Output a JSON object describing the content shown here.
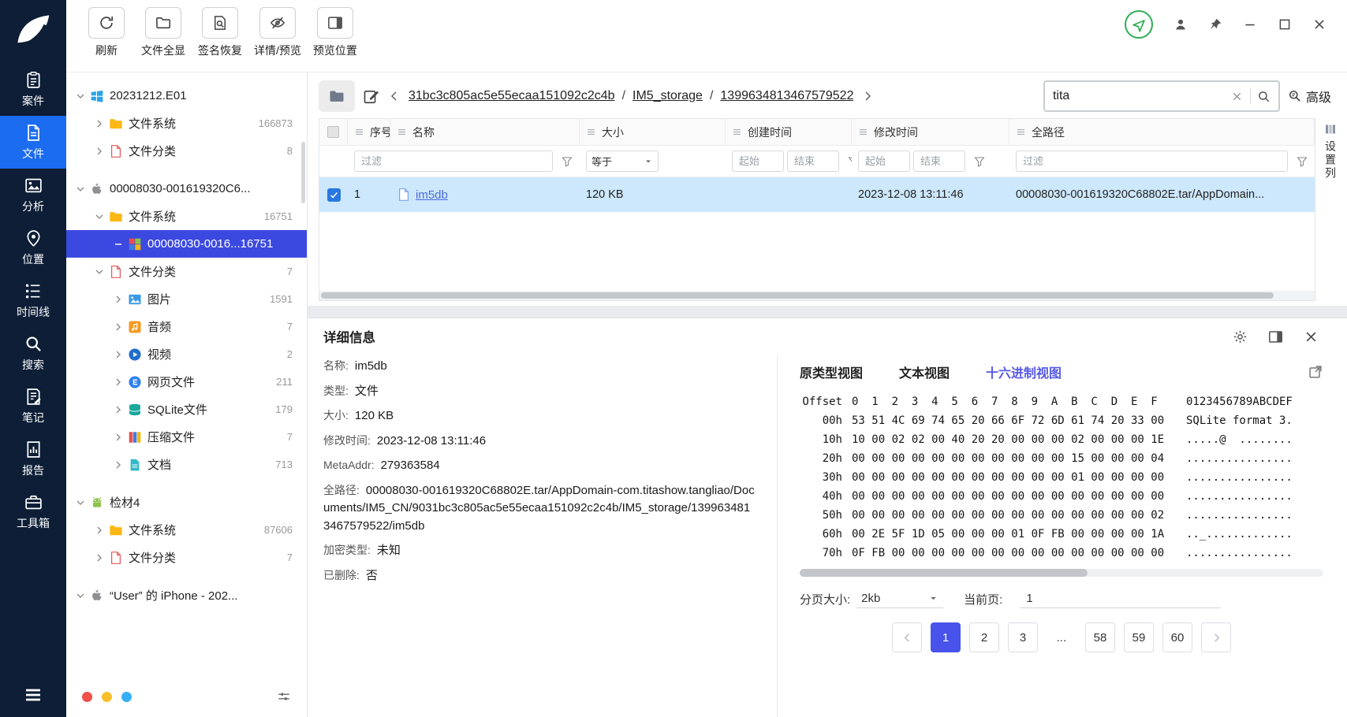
{
  "nav": {
    "items": [
      {
        "id": "case",
        "label": "案件",
        "icon": "case-icon",
        "active": false
      },
      {
        "id": "files",
        "label": "文件",
        "icon": "files-icon",
        "active": true
      },
      {
        "id": "analysis",
        "label": "分析",
        "icon": "analysis-icon",
        "active": false
      },
      {
        "id": "location",
        "label": "位置",
        "icon": "location-icon",
        "active": false
      },
      {
        "id": "timeline",
        "label": "时间线",
        "icon": "timeline-icon",
        "active": false
      },
      {
        "id": "search",
        "label": "搜索",
        "icon": "search-icon",
        "active": false
      },
      {
        "id": "notes",
        "label": "笔记",
        "icon": "notes-icon",
        "active": false
      },
      {
        "id": "report",
        "label": "报告",
        "icon": "report-icon",
        "active": false
      },
      {
        "id": "toolbox",
        "label": "工具箱",
        "icon": "toolbox-icon",
        "active": false
      }
    ]
  },
  "toolbar": {
    "buttons": [
      {
        "id": "refresh",
        "label": "刷新",
        "icon": "refresh-icon"
      },
      {
        "id": "show-all-files",
        "label": "文件全显",
        "icon": "folder-icon"
      },
      {
        "id": "signature-recovery",
        "label": "签名恢复",
        "icon": "signature-icon"
      },
      {
        "id": "detail-preview",
        "label": "详情/预览",
        "icon": "eye-off-icon"
      },
      {
        "id": "preview-position",
        "label": "预览位置",
        "icon": "layout-icon"
      }
    ]
  },
  "tree": {
    "items": [
      {
        "level": 0,
        "chev": "down",
        "icon": "windows",
        "label": "20231212.E01",
        "count": "",
        "selected": false
      },
      {
        "level": 1,
        "chev": "right",
        "icon": "folder",
        "label": "文件系统",
        "count": "166873",
        "selected": false
      },
      {
        "level": 1,
        "chev": "right",
        "icon": "file-cat",
        "label": "文件分类",
        "count": "8",
        "selected": false
      },
      {
        "level": 0,
        "chev": "down",
        "icon": "apple",
        "label": "00008030-001619320C6...",
        "count": "",
        "selected": false
      },
      {
        "level": 1,
        "chev": "down",
        "icon": "folder",
        "label": "文件系统",
        "count": "16751",
        "selected": false
      },
      {
        "level": 2,
        "chev": "minus",
        "icon": "disk",
        "label": "00008030-0016...16751",
        "count": "",
        "selected": true
      },
      {
        "level": 1,
        "chev": "down",
        "icon": "file-cat",
        "label": "文件分类",
        "count": "7",
        "selected": false
      },
      {
        "level": 2,
        "chev": "right",
        "icon": "image",
        "label": "图片",
        "count": "1591",
        "selected": false
      },
      {
        "level": 2,
        "chev": "right",
        "icon": "audio",
        "label": "音频",
        "count": "7",
        "selected": false
      },
      {
        "level": 2,
        "chev": "right",
        "icon": "video",
        "label": "视频",
        "count": "2",
        "selected": false
      },
      {
        "level": 2,
        "chev": "right",
        "icon": "web",
        "label": "网页文件",
        "count": "211",
        "selected": false
      },
      {
        "level": 2,
        "chev": "right",
        "icon": "sqlite",
        "label": "SQLite文件",
        "count": "179",
        "selected": false
      },
      {
        "level": 2,
        "chev": "right",
        "icon": "zip",
        "label": "压缩文件",
        "count": "7",
        "selected": false
      },
      {
        "level": 2,
        "chev": "right",
        "icon": "doc",
        "label": "文档",
        "count": "713",
        "selected": false
      },
      {
        "level": 0,
        "chev": "down",
        "icon": "android",
        "label": "检材4",
        "count": "",
        "selected": false
      },
      {
        "level": 1,
        "chev": "right",
        "icon": "folder",
        "label": "文件系统",
        "count": "87606",
        "selected": false
      },
      {
        "level": 1,
        "chev": "right",
        "icon": "file-cat",
        "label": "文件分类",
        "count": "7",
        "selected": false
      },
      {
        "level": 0,
        "chev": "down",
        "icon": "apple",
        "label": "“User” 的 iPhone - 202...",
        "count": "",
        "selected": false
      }
    ]
  },
  "breadcrumb": {
    "segments": [
      "31bc3c805ac5e55ecaa151092c2c4b",
      "IM5_storage",
      "1399634813467579522"
    ],
    "separator": "/"
  },
  "search": {
    "value": "tita",
    "advanced_label": "高级"
  },
  "table": {
    "columns": [
      {
        "label": "序号"
      },
      {
        "label": "名称"
      },
      {
        "label": "大小"
      },
      {
        "label": "创建时间"
      },
      {
        "label": "修改时间"
      },
      {
        "label": "全路径"
      }
    ],
    "filters": {
      "name_placeholder": "过滤",
      "size_operator": "等于",
      "time_start": "起始",
      "time_end": "结束",
      "path_placeholder": "过滤"
    },
    "rows": [
      {
        "checked": true,
        "selected": true,
        "index": "1",
        "name": "im5db",
        "size": "120 KB",
        "created": "",
        "modified": "2023-12-08 13:11:46",
        "path": "00008030-001619320C68802E.tar/AppDomain..."
      }
    ],
    "column_settings_label": "设置列"
  },
  "detail": {
    "title": "详细信息",
    "tabs": [
      "原类型视图",
      "文本视图",
      "十六进制视图"
    ],
    "active_tab": 2,
    "fields": [
      {
        "label": "名称:",
        "value": "im5db"
      },
      {
        "label": "类型:",
        "value": "文件"
      },
      {
        "label": "大小:",
        "value": "120 KB"
      },
      {
        "label": "修改时间:",
        "value": "2023-12-08 13:11:46"
      },
      {
        "label": "MetaAddr:",
        "value": "279363584"
      },
      {
        "label": "全路径:",
        "value": "00008030-001619320C68802E.tar/AppDomain-com.titashow.tangliao/Documents/IM5_CN/9031bc3c805ac5e55ecaa151092c2c4b/IM5_storage/1399634813467579522/im5db"
      },
      {
        "label": "加密类型:",
        "value": "未知"
      },
      {
        "label": "已删除:",
        "value": "否"
      }
    ]
  },
  "hex": {
    "offset_header": "Offset",
    "cols_header": "0  1  2  3  4  5  6  7  8  9  A  B  C  D  E  F",
    "ascii_header": "0123456789ABCDEF",
    "lines": [
      {
        "offset": "00h",
        "bytes": "53 51 4C 69 74 65 20 66 6F 72 6D 61 74 20 33 00",
        "ascii": "SQLite format 3."
      },
      {
        "offset": "10h",
        "bytes": "10 00 02 02 00 40 20 20 00 00 00 02 00 00 00 1E",
        "ascii": ".....@  ........"
      },
      {
        "offset": "20h",
        "bytes": "00 00 00 00 00 00 00 00 00 00 00 15 00 00 00 04",
        "ascii": "................"
      },
      {
        "offset": "30h",
        "bytes": "00 00 00 00 00 00 00 00 00 00 00 01 00 00 00 00",
        "ascii": "................"
      },
      {
        "offset": "40h",
        "bytes": "00 00 00 00 00 00 00 00 00 00 00 00 00 00 00 00",
        "ascii": "................"
      },
      {
        "offset": "50h",
        "bytes": "00 00 00 00 00 00 00 00 00 00 00 00 00 00 00 02",
        "ascii": "................"
      },
      {
        "offset": "60h",
        "bytes": "00 2E 5F 1D 05 00 00 00 01 0F FB 00 00 00 00 1A",
        "ascii": ".._............."
      },
      {
        "offset": "70h",
        "bytes": "0F FB 00 00 00 00 00 00 00 00 00 00 00 00 00 00",
        "ascii": "................"
      }
    ]
  },
  "pager": {
    "size_label": "分页大小:",
    "size_value": "2kb",
    "current_label": "当前页:",
    "current_value": "1",
    "pages": [
      "1",
      "2",
      "3",
      "...",
      "58",
      "59",
      "60"
    ],
    "active": "1"
  }
}
